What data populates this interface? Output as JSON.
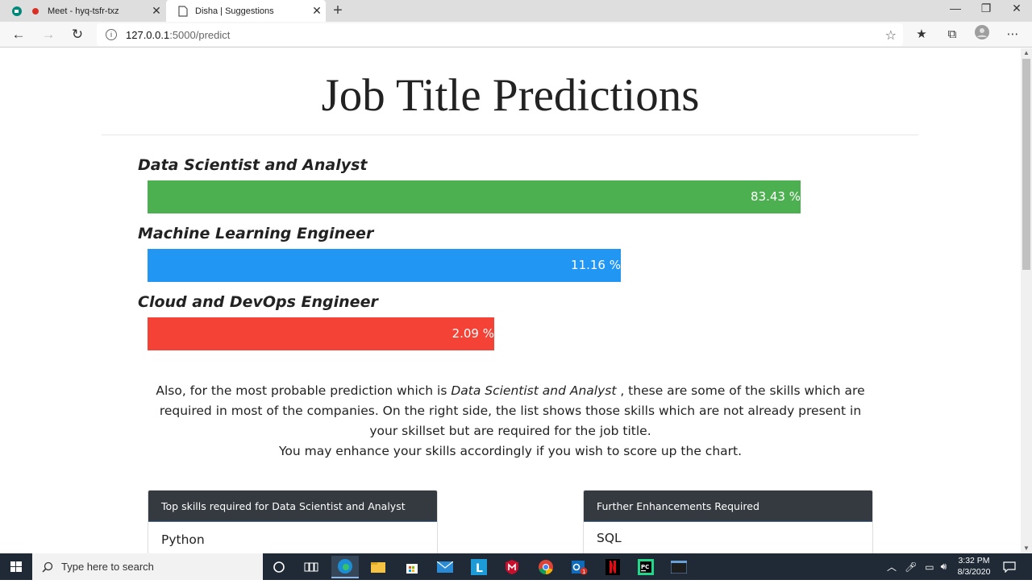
{
  "browser": {
    "tabs": [
      {
        "title": "Meet - hyq-tsfr-txz",
        "active": false
      },
      {
        "title": "Disha | Suggestions",
        "active": true
      }
    ],
    "url_host": "127.0.0.1",
    "url_path": ":5000/predict"
  },
  "page": {
    "title": "Job Title Predictions",
    "predictions": [
      {
        "label": "Data Scientist and Analyst",
        "percent_text": "83.43 %",
        "percent": 83.43,
        "color": "#4caf50"
      },
      {
        "label": "Machine Learning Engineer",
        "percent_text": "11.16 %",
        "percent": 11.16,
        "color": "#2196f3"
      },
      {
        "label": "Cloud and DevOps Engineer",
        "percent_text": "2.09 %",
        "percent": 2.09,
        "color": "#f44336"
      }
    ],
    "description": {
      "part1": "Also, for the most probable prediction which is ",
      "emph": "Data Scientist and Analyst",
      "part2": " , these are some of the skills which are required in most of the companies. On the right side, the list shows those skills which are not already present in your skillset but are required for the job title.",
      "line2": "You may enhance your skills accordingly if you wish to score up the chart."
    },
    "cards": [
      {
        "header": "Top skills required for Data Scientist and Analyst",
        "items": [
          "Python"
        ]
      },
      {
        "header": "Further Enhancements Required",
        "items": [
          "SQL"
        ]
      }
    ]
  },
  "taskbar": {
    "search_placeholder": "Type here to search",
    "time": "3:32 PM",
    "date": "8/3/2020",
    "mail_badge": "1"
  }
}
